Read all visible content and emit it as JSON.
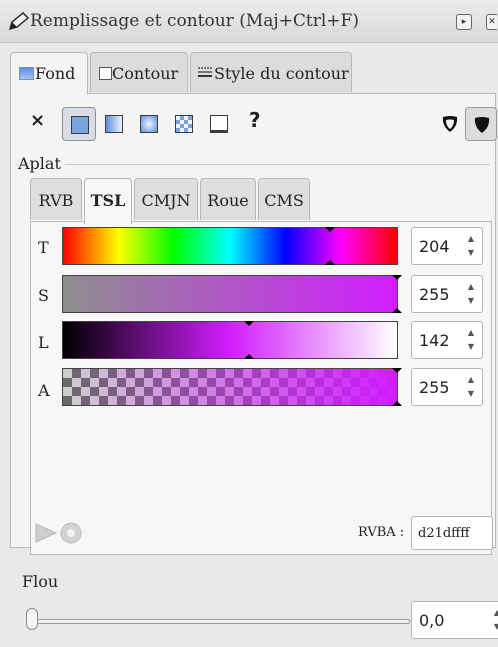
{
  "window": {
    "title": "Remplissage et contour (Maj+Ctrl+F)",
    "icon": "fill-stroke-pen-icon",
    "buttons": [
      "dock-restore-icon",
      "close-icon"
    ]
  },
  "tabs": [
    {
      "label": "Fond",
      "icon": "fill-swatch-icon",
      "active": true
    },
    {
      "label": "Contour",
      "icon": "stroke-swatch-icon",
      "active": false
    },
    {
      "label": "Style du contour",
      "icon": "stroke-style-icon",
      "active": false
    }
  ],
  "fill_modes": {
    "none_label": "×",
    "unknown_label": "?",
    "items": [
      "no-paint-icon",
      "flat-color-icon",
      "linear-gradient-icon",
      "radial-gradient-icon",
      "pattern-icon",
      "swatch-icon",
      "unset-paint-icon"
    ],
    "selected": "flat-color-icon",
    "fill_rule_icons": [
      "fill-rule-evenodd-icon",
      "fill-rule-nonzero-icon"
    ]
  },
  "aplat": {
    "label": "Aplat",
    "color_tabs": [
      "RVB",
      "TSL",
      "CMJN",
      "Roue",
      "CMS"
    ],
    "active_tab": "TSL",
    "sliders": [
      {
        "label": "T",
        "value": "204",
        "marker": 0.8
      },
      {
        "label": "S",
        "value": "255",
        "marker": 1.0
      },
      {
        "label": "L",
        "value": "142",
        "marker": 0.557
      },
      {
        "label": "A",
        "value": "255",
        "marker": 1.0
      }
    ],
    "picker_icons": [
      "color-picker-icon",
      "color-managed-icon"
    ],
    "rvba_label": "RVBA :",
    "rvba_value": "d21dffff"
  },
  "flou": {
    "label": "Flou",
    "value": "0,0",
    "slider_fraction": 0.0
  },
  "colors": {
    "current": "#d21dff",
    "accent": "#4a7fd6"
  }
}
